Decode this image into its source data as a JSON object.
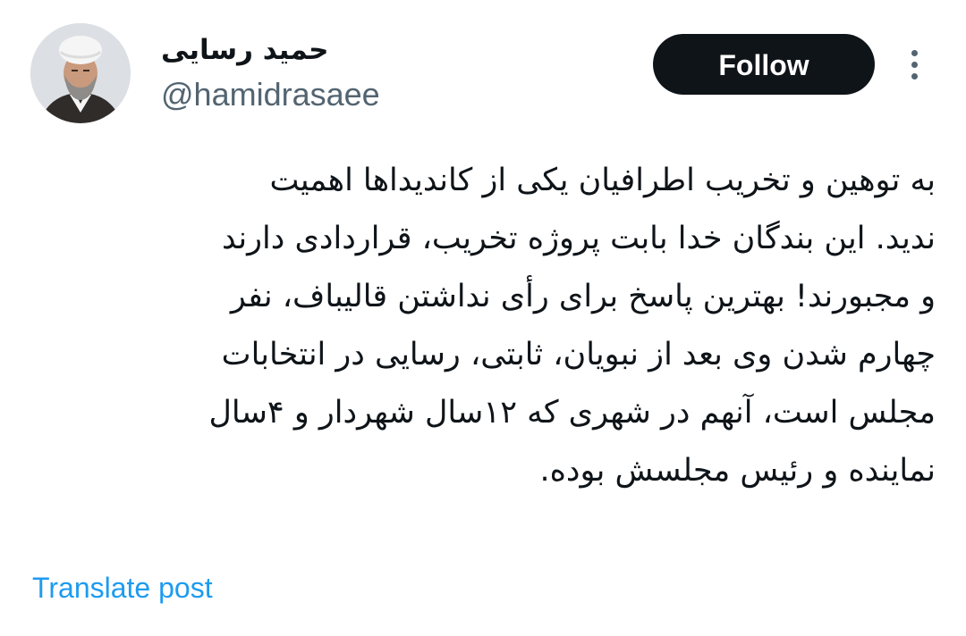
{
  "author": {
    "display_name": "حمید رسایی",
    "handle": "@hamidrasaee"
  },
  "actions": {
    "follow_label": "Follow",
    "more_icon": "more-vertical-icon"
  },
  "tweet": {
    "lines": [
      "به توهین و تخریب اطرافیان یکی از کاندیداها اهمیت",
      "ندید. این بندگان خدا بابت پروژه تخریب، قراردادی دارند",
      "و مجبورند! بهترین پاسخ برای رأی نداشتن قالیباف، نفر",
      "چهارم شدن وی بعد از نبویان، ثابتی، رسایی در انتخابات",
      "مجلس است، آنهم در شهری که ۱۲سال شهردار و ۴سال",
      "نماینده و رئیس مجلسش بوده."
    ]
  },
  "footer": {
    "translate_label": "Translate post"
  },
  "colors": {
    "text": "#0f1419",
    "secondary": "#536471",
    "link": "#1d9bf0",
    "button_bg": "#0f1419",
    "button_text": "#ffffff"
  }
}
